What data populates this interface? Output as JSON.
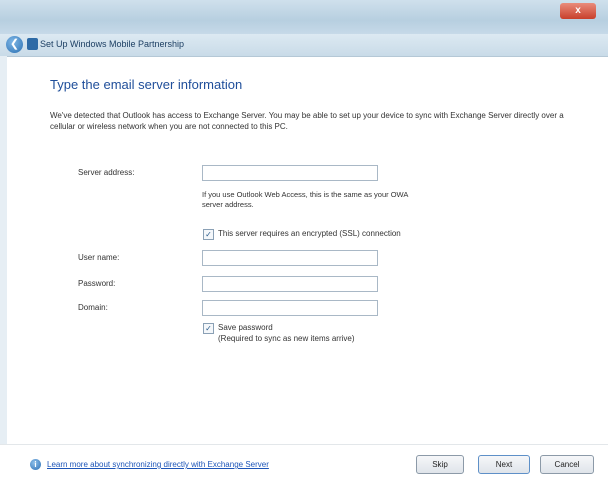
{
  "window": {
    "close_glyph": "x"
  },
  "nav": {
    "title": "Set Up Windows Mobile Partnership",
    "back_glyph": "❮"
  },
  "heading": "Type the email server information",
  "description": "We've detected that Outlook has access to Exchange Server. You may be able to set up your device to sync with Exchange Server directly over a cellular or wireless network when you are not connected to this PC.",
  "form": {
    "server_label": "Server address:",
    "server_value": "",
    "server_hint": "If you use Outlook Web Access, this is the same as your OWA server address.",
    "ssl_checkbox_checked": true,
    "ssl_label": "This server requires an encrypted (SSL) connection",
    "username_label": "User name:",
    "username_value": "",
    "password_label": "Password:",
    "password_value": "",
    "domain_label": "Domain:",
    "domain_value": "",
    "save_password_checked": true,
    "save_password_label": "Save password",
    "save_password_note": "(Required to sync as new items arrive)"
  },
  "footer": {
    "learn_link": "Learn more about synchronizing directly with Exchange Server",
    "skip": "Skip",
    "next": "Next",
    "cancel": "Cancel"
  },
  "colors": {
    "heading": "#1f4e9a",
    "link": "#1d55b8",
    "titlebar": "#b7cfe0"
  }
}
